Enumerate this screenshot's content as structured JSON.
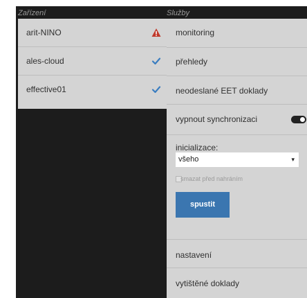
{
  "devices_header": "Zařízení",
  "services_header": "Služby",
  "devices": [
    {
      "label": "arit-NINO",
      "status_icon": "warning-icon",
      "status_color": "#c0392b"
    },
    {
      "label": "ales-cloud",
      "status_icon": "check-icon",
      "status_color": "#3a7dc0"
    },
    {
      "label": "effective01",
      "status_icon": "check-icon",
      "status_color": "#3a7dc0"
    }
  ],
  "services": {
    "monitoring": "monitoring",
    "overviews": "přehledy",
    "unsent_eet": "neodeslané EET doklady",
    "disable_sync": "vypnout synchronizaci",
    "disable_sync_on": true,
    "init_label": "inicializace:",
    "init_select_value": "všeho",
    "delete_before_upload": "smazat před nahráním",
    "delete_before_upload_checked": false,
    "run_button": "spustit",
    "settings": "nastavení",
    "printed_receipts": "vytištěné doklady"
  },
  "colors": {
    "background": "#1c1c1c",
    "panel": "#d4d4d4",
    "accent": "#3b76b0",
    "warning": "#c0392b",
    "check": "#3a7dc0"
  }
}
